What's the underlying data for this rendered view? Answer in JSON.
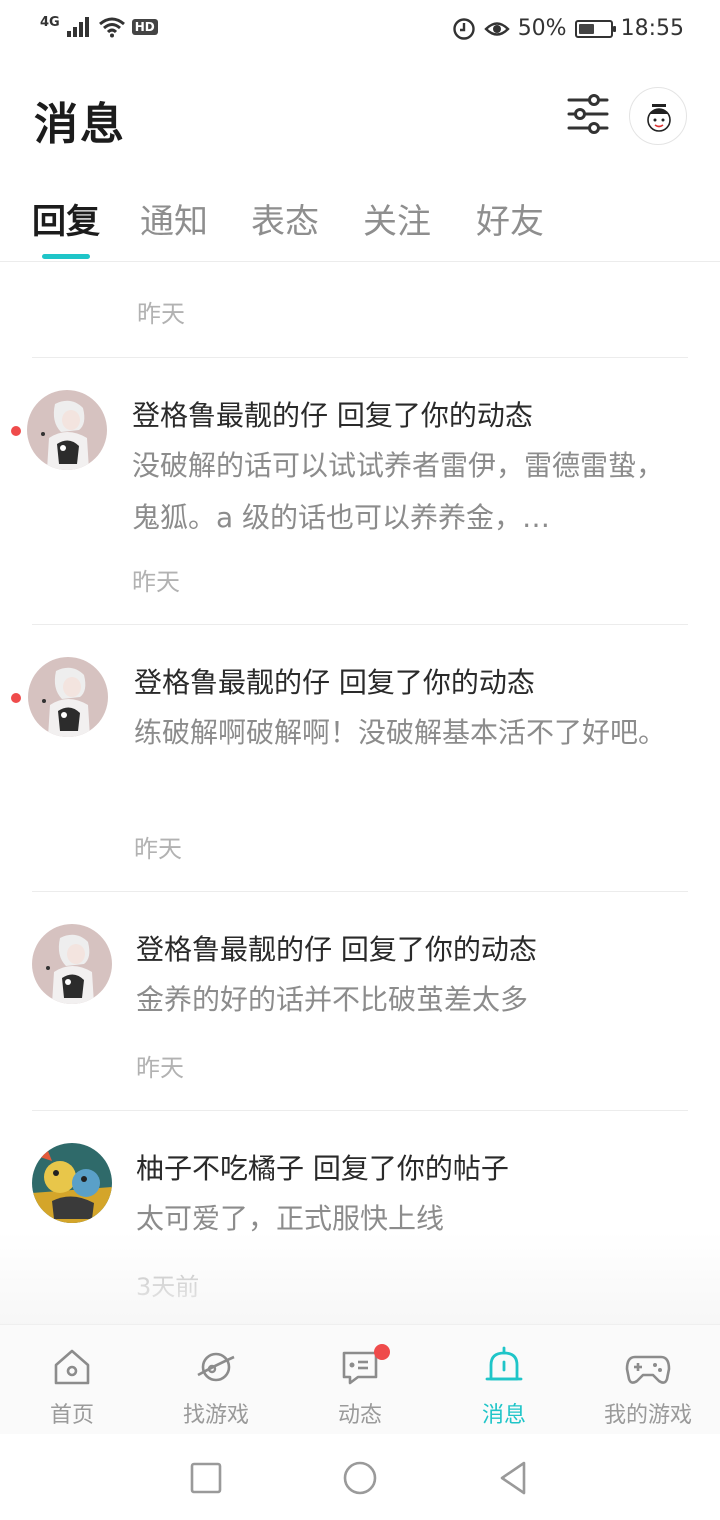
{
  "status_bar": {
    "network": "4G",
    "hd": "HD",
    "battery_text": "50%",
    "battery_level": 0.5,
    "time": "18:55"
  },
  "header": {
    "title": "消息",
    "filter_icon": "sliders-icon",
    "avatar_icon": "user-avatar"
  },
  "tabs": [
    {
      "label": "回复",
      "active": true
    },
    {
      "label": "通知",
      "active": false
    },
    {
      "label": "表态",
      "active": false
    },
    {
      "label": "关注",
      "active": false
    },
    {
      "label": "好友",
      "active": false
    }
  ],
  "list": {
    "first_time": "昨天",
    "items": [
      {
        "title": "登格鲁最靓的仔 回复了你的动态",
        "body": "没破解的话可以试试养者雷伊，雷德雷蛰，鬼狐。a 级的话也可以养养金，…",
        "time": "昨天",
        "unread": true
      },
      {
        "title": "登格鲁最靓的仔 回复了你的动态",
        "body": "练破解啊破解啊！没破解基本活不了好吧。",
        "time": "昨天",
        "unread": true
      },
      {
        "title": "登格鲁最靓的仔 回复了你的动态",
        "body": "金养的好的话并不比破茧差太多",
        "time": "昨天",
        "unread": false
      },
      {
        "title": "柚子不吃橘子 回复了你的帖子",
        "body": "太可爱了，正式服快上线",
        "time": "3天前",
        "unread": false
      }
    ]
  },
  "bottom_nav": [
    {
      "label": "首页",
      "icon": "home-icon"
    },
    {
      "label": "找游戏",
      "icon": "planet-icon"
    },
    {
      "label": "动态",
      "icon": "chat-icon",
      "badge": true
    },
    {
      "label": "消息",
      "icon": "bell-icon",
      "active": true
    },
    {
      "label": "我的游戏",
      "icon": "gamepad-icon"
    }
  ],
  "colors": {
    "accent": "#1fc5c8",
    "badge": "#ef4b4b",
    "title": "#1c1c1c",
    "secondary_text": "#8c8c8c",
    "time_text": "#b2b2b2"
  }
}
